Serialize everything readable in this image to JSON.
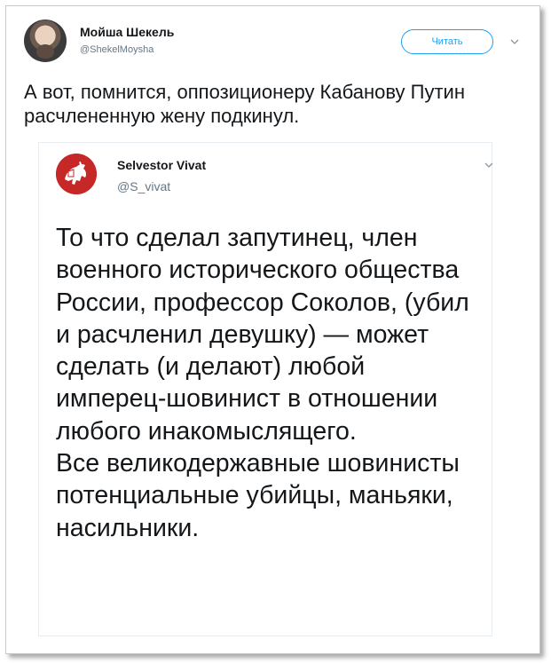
{
  "tweet": {
    "author_name": "Мойша Шекель",
    "author_handle": "@ShekelMoysha",
    "follow_label": "Читать",
    "text": "А вот, помнится, оппозиционеру Кабанову Путин расчлененную жену подкинул."
  },
  "quoted": {
    "author_name": "Selvestor Vivat",
    "author_handle": "@S_vivat",
    "paragraph1": "То что сделал запутинец, член военного исторического общества России, профессор Соколов, (убил и расчленил девушку) — может сделать (и делают) любой имперец-шовинист в отношении любого инакомыслящего.",
    "paragraph2": "Все великодержавные шовинисты потенциальные убийцы, маньяки, насильники."
  },
  "icons": {
    "more": "chevron-down-icon",
    "quoted_avatar": "pahonia-emblem"
  },
  "colors": {
    "accent": "#1da1f2",
    "text": "#14171a",
    "muted": "#657786",
    "emblem_red": "#c62828"
  }
}
